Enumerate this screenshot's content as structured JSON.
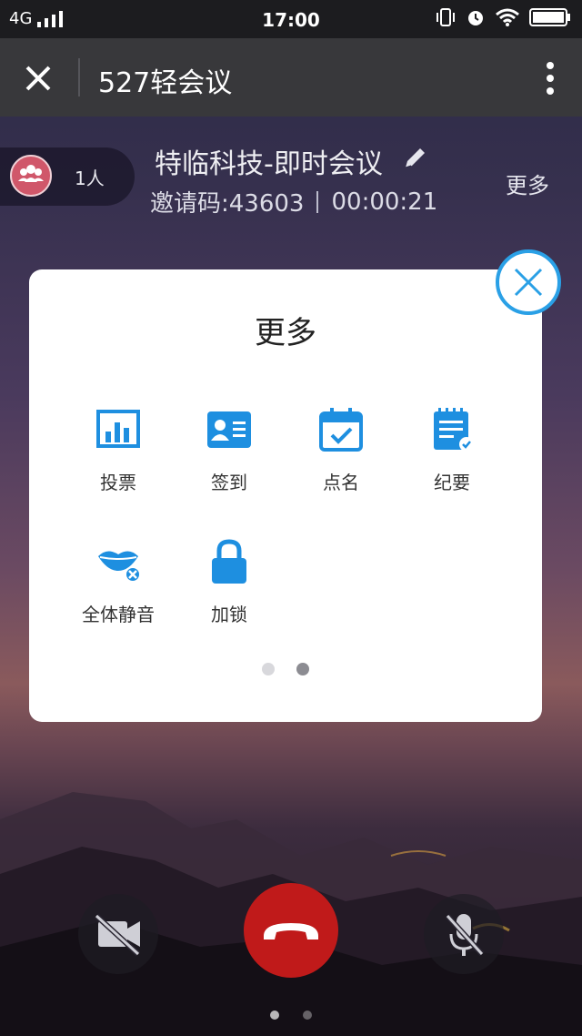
{
  "status_bar": {
    "network": "4G",
    "time": "17:00",
    "icons": [
      "signal-icon",
      "vibrate-icon",
      "alarm-icon",
      "wifi-icon",
      "battery-icon"
    ]
  },
  "title_bar": {
    "title": "527轻会议",
    "icons": [
      "close-icon",
      "more-vert-icon"
    ]
  },
  "meeting": {
    "participants": "1人",
    "name": "特临科技-即时会议",
    "invite_code": "邀请码:43603",
    "duration": "00:00:21",
    "more_label": "更多"
  },
  "more_panel": {
    "title": "更多",
    "items": [
      {
        "label": "投票",
        "icon": "vote-chart-icon"
      },
      {
        "label": "签到",
        "icon": "sign-in-card-icon"
      },
      {
        "label": "点名",
        "icon": "roll-call-calendar-icon"
      },
      {
        "label": "纪要",
        "icon": "minutes-notepad-icon"
      },
      {
        "label": "全体静音",
        "icon": "mute-all-lips-icon"
      },
      {
        "label": "加锁",
        "icon": "lock-icon"
      }
    ],
    "page_indicator": {
      "pages": 2,
      "current": 2
    }
  },
  "call_controls": {
    "icons": [
      "camera-off-icon",
      "hangup-icon",
      "mic-off-icon"
    ]
  },
  "colors": {
    "accent": "#2aa0e6",
    "hangup": "#c01a1a",
    "avatar": "#d0576a"
  }
}
